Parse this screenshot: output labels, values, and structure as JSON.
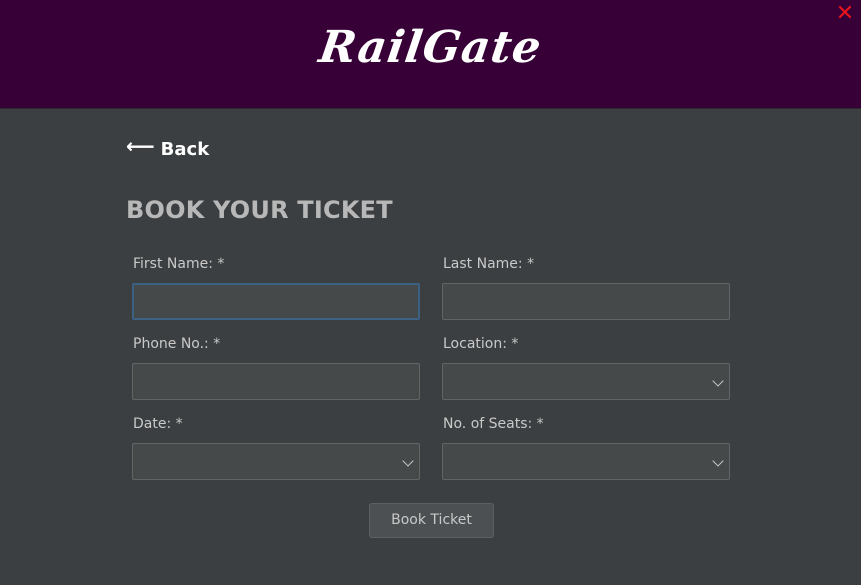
{
  "app": {
    "logo_text": "RailGate",
    "close_glyph": "✕"
  },
  "nav": {
    "back_arrow": "⟵",
    "back_label": "Back"
  },
  "page": {
    "title": "BOOK YOUR TICKET"
  },
  "form": {
    "first_name": {
      "label": "First Name: *",
      "value": ""
    },
    "last_name": {
      "label": "Last Name: *",
      "value": ""
    },
    "phone": {
      "label": "Phone No.: *",
      "value": ""
    },
    "location": {
      "label": "Location: *",
      "selected": ""
    },
    "date": {
      "label": "Date: *",
      "selected": ""
    },
    "seats": {
      "label": "No. of Seats: *",
      "selected": ""
    },
    "submit_label": "Book Ticket"
  },
  "colors": {
    "header_bg": "#370036",
    "body_bg": "#3c3f41",
    "close_red": "#e8141d",
    "focus_border": "#3d6185"
  }
}
